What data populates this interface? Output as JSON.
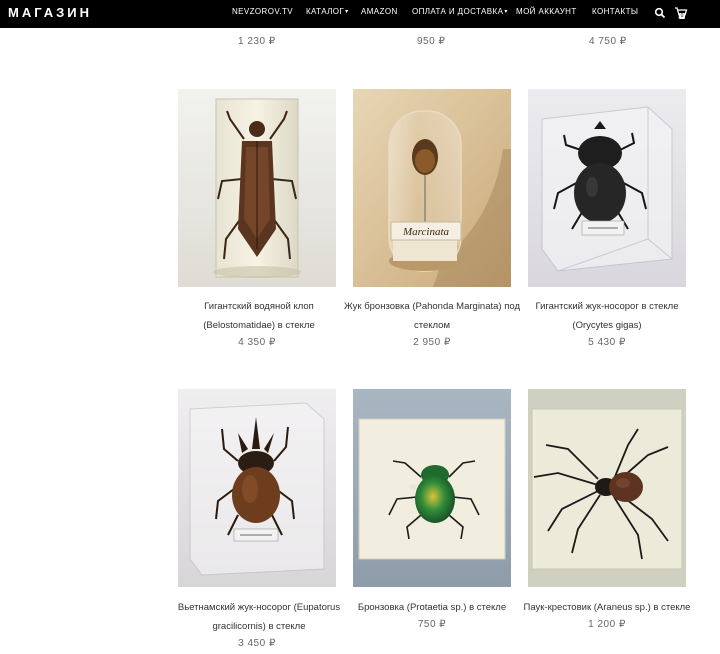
{
  "header": {
    "brand": "МАГАЗИН",
    "nav": [
      {
        "label": "NEVZOROV.TV"
      },
      {
        "label": "КАТАЛОГ",
        "caret": "▾"
      },
      {
        "label": "AMAZON"
      },
      {
        "label": "ОПЛАТА И ДОСТАВКА",
        "caret": "▾"
      },
      {
        "label": "МОЙ АККАУНТ"
      },
      {
        "label": "КОНТАКТЫ"
      }
    ],
    "cart_count": "0",
    "icons": [
      "search-icon",
      "cart-icon"
    ]
  },
  "prev_row_prices": [
    "1 230 ₽",
    "950 ₽",
    "4 750 ₽"
  ],
  "products": [
    {
      "title_lines": [
        "Гигантский водяной клоп",
        "(Belostomatidae) в стекле"
      ],
      "price": "4 350 ₽"
    },
    {
      "title_lines": [
        "Жук бронзовка (Pahonda Marginata) под",
        "стеклом"
      ],
      "price": "2 950 ₽",
      "label_text": "Marcinata"
    },
    {
      "title_lines": [
        "Гигантский жук-носорог в стекле",
        "(Orycytes gigas)"
      ],
      "price": "5 430 ₽"
    },
    {
      "title_lines": [
        "Вьетнамский жук-носорог (Eupatorus",
        "gracilicornis) в стекле"
      ],
      "price": "3 450 ₽"
    },
    {
      "title_lines": [
        "Бронзовка (Protaetia sp.) в стекле"
      ],
      "price": "750 ₽"
    },
    {
      "title_lines": [
        "Паук-крестовик (Araneus sp.) в стекле"
      ],
      "price": "1 200 ₽"
    }
  ]
}
